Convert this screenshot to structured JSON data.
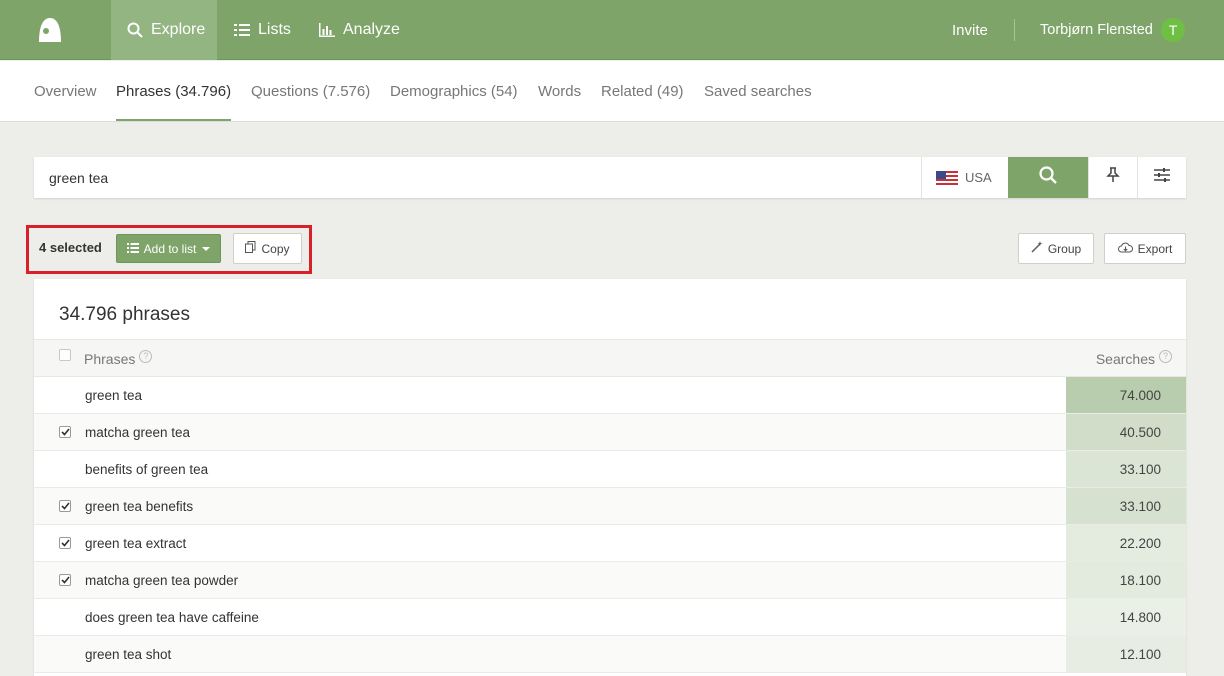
{
  "nav": {
    "explore": "Explore",
    "lists": "Lists",
    "analyze": "Analyze",
    "invite": "Invite",
    "user_name": "Torbjørn Flensted",
    "avatar_initial": "T"
  },
  "tabs": [
    {
      "label": "Overview"
    },
    {
      "label": "Phrases (34.796)"
    },
    {
      "label": "Questions (7.576)"
    },
    {
      "label": "Demographics (54)"
    },
    {
      "label": "Words"
    },
    {
      "label": "Related (49)"
    },
    {
      "label": "Saved searches"
    }
  ],
  "search": {
    "value": "green tea",
    "country": "USA"
  },
  "toolbar": {
    "selected": "4 selected",
    "add_to_list": "Add to list",
    "copy": "Copy",
    "group": "Group",
    "export": "Export"
  },
  "table": {
    "title": "34.796 phrases",
    "col_phrases": "Phrases",
    "col_searches": "Searches",
    "rows": [
      {
        "phrase": "green tea",
        "searches": "74.000",
        "checked": false
      },
      {
        "phrase": "matcha green tea",
        "searches": "40.500",
        "checked": true
      },
      {
        "phrase": "benefits of green tea",
        "searches": "33.100",
        "checked": false
      },
      {
        "phrase": "green tea benefits",
        "searches": "33.100",
        "checked": true
      },
      {
        "phrase": "green tea extract",
        "searches": "22.200",
        "checked": true
      },
      {
        "phrase": "matcha green tea powder",
        "searches": "18.100",
        "checked": true
      },
      {
        "phrase": "does green tea have caffeine",
        "searches": "14.800",
        "checked": false
      },
      {
        "phrase": "green tea shot",
        "searches": "12.100",
        "checked": false
      }
    ]
  },
  "colors": {
    "brand_green": "#7ea46a",
    "highlight_red": "#d8202a",
    "searches_heat": "#b3c9a4"
  },
  "icons": [
    "logo-icon",
    "search-icon",
    "list-icon",
    "bar-chart-icon",
    "us-flag-icon",
    "pin-icon",
    "sliders-icon",
    "copy-icon",
    "wand-icon",
    "cloud-download-icon",
    "help-icon",
    "check-icon"
  ]
}
